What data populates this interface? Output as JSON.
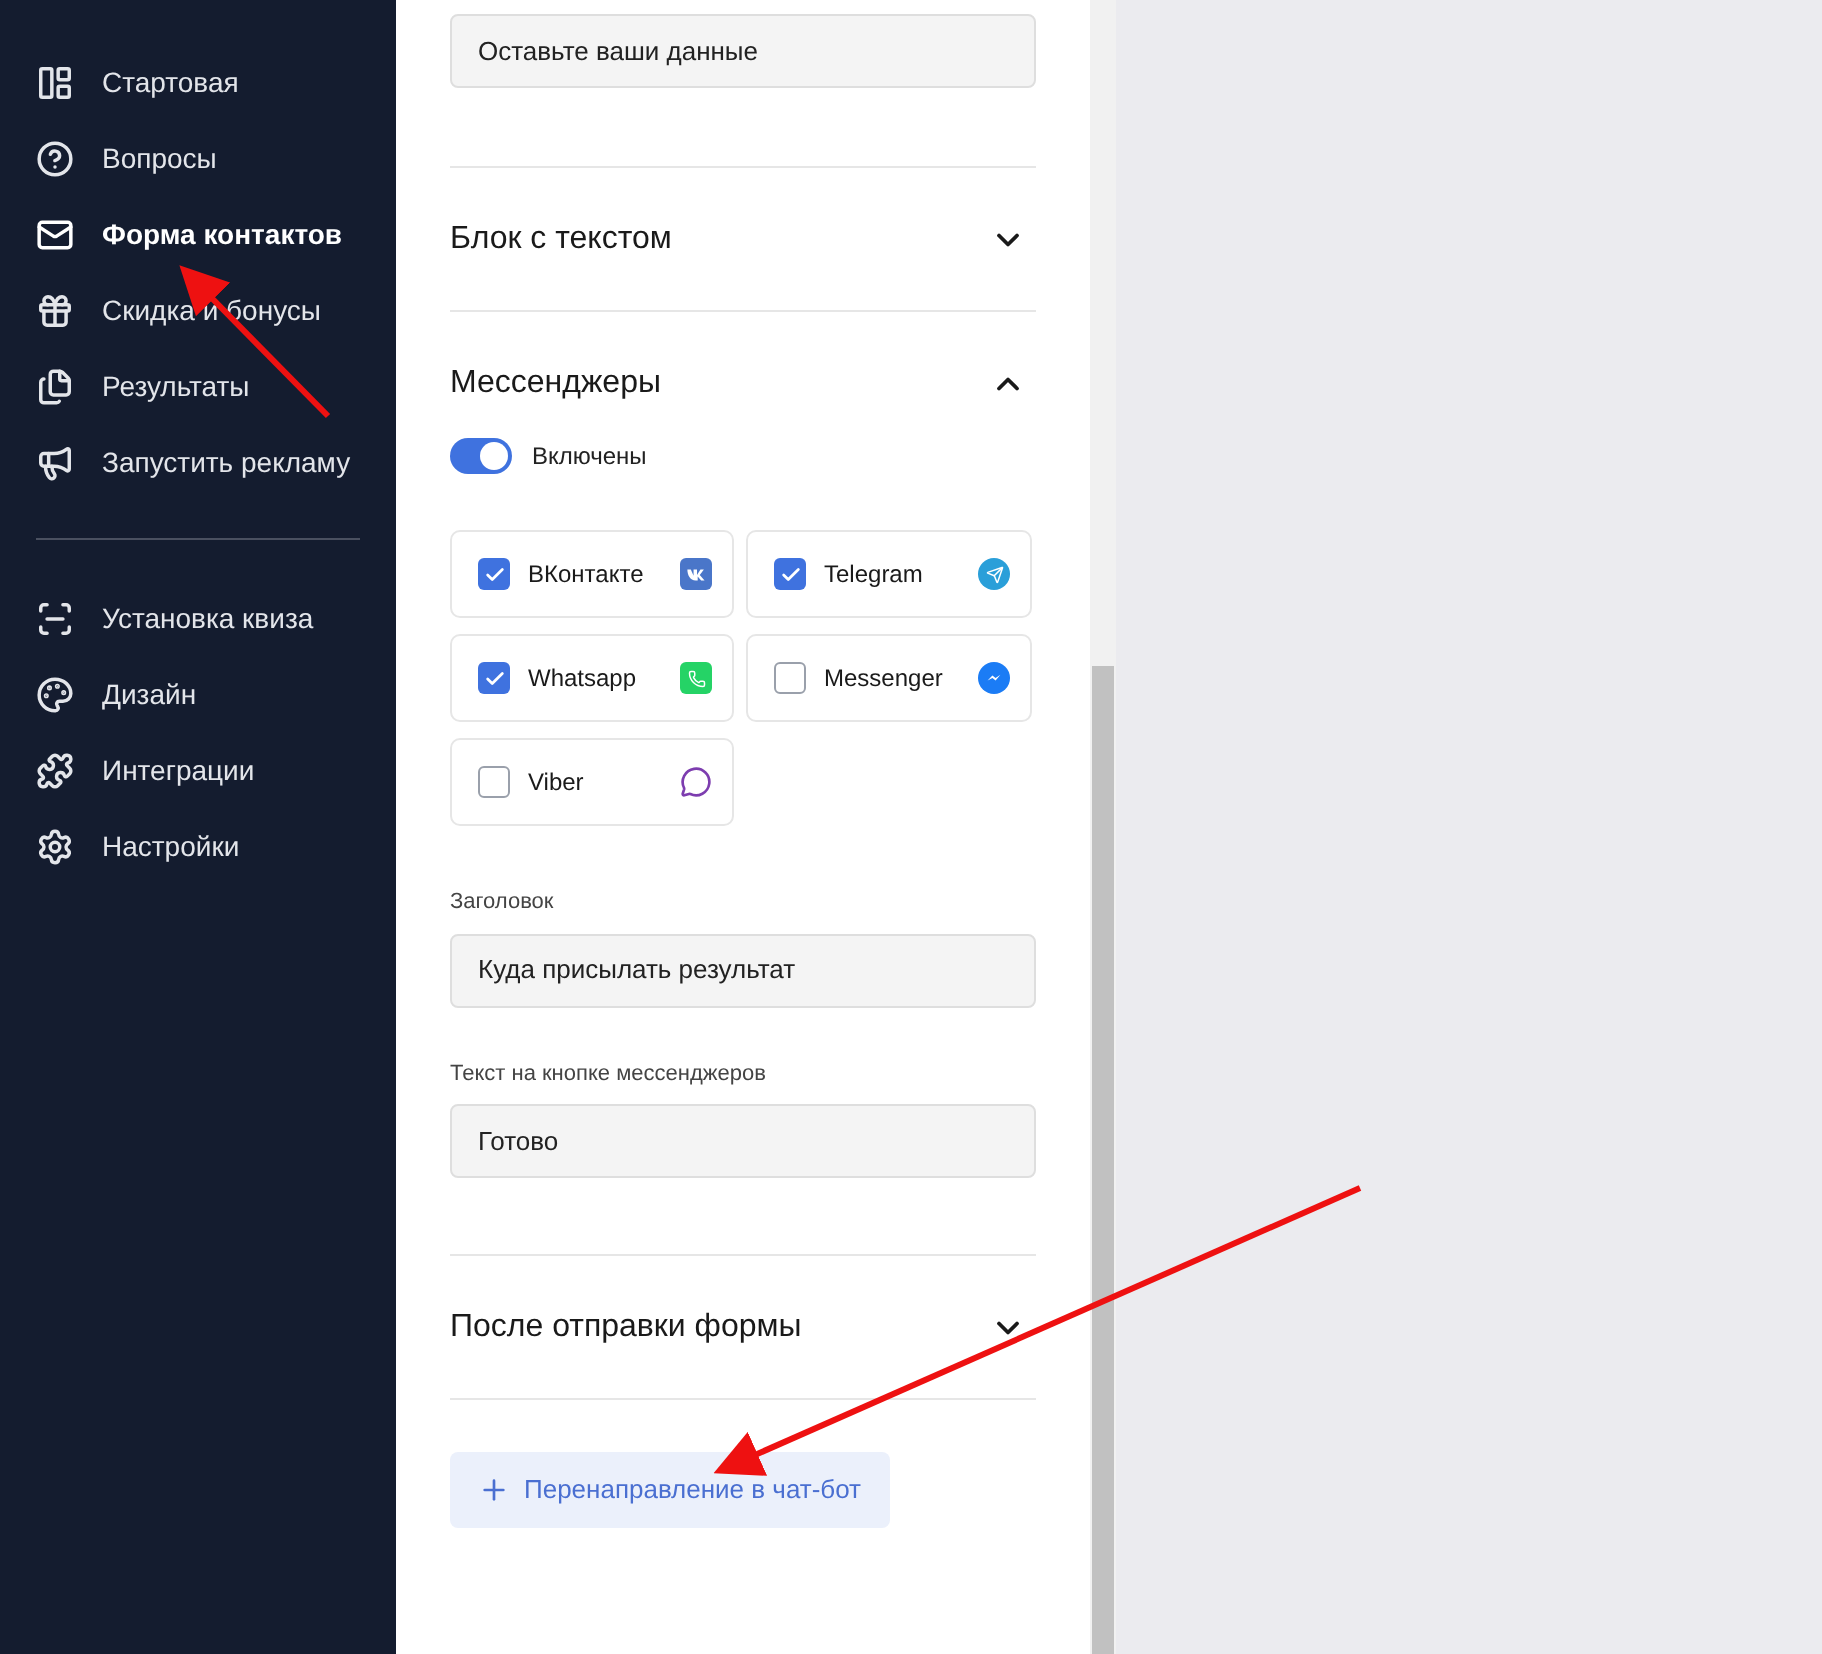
{
  "sidebar": {
    "sections": [
      {
        "items": [
          {
            "label": "Стартовая",
            "selected": false
          },
          {
            "label": "Вопросы",
            "selected": false
          },
          {
            "label": "Форма контактов",
            "selected": true
          },
          {
            "label": "Скидка и бонусы",
            "selected": false
          },
          {
            "label": "Результаты",
            "selected": false
          },
          {
            "label": "Запустить рекламу",
            "selected": false
          }
        ]
      },
      {
        "items": [
          {
            "label": "Установка квиза",
            "selected": false
          },
          {
            "label": "Дизайн",
            "selected": false
          },
          {
            "label": "Интеграции",
            "selected": false
          },
          {
            "label": "Настройки",
            "selected": false
          }
        ]
      }
    ]
  },
  "panel": {
    "top_field": {
      "value": "Оставьте ваши данные"
    },
    "sections": [
      {
        "title": "Блок с текстом",
        "expanded": false
      },
      {
        "title": "Мессенджеры",
        "expanded": true,
        "toggle": {
          "label": "Включены",
          "on": true
        },
        "messengers": [
          {
            "label": "ВКонтакте",
            "checked": true
          },
          {
            "label": "Telegram",
            "checked": true
          },
          {
            "label": "Whatsapp",
            "checked": true
          },
          {
            "label": "Messenger",
            "checked": false
          },
          {
            "label": "Viber",
            "checked": false
          }
        ],
        "fields": [
          {
            "label": "Заголовок",
            "value": "Куда присылать результат"
          },
          {
            "label": "Текст на кнопке мессенджеров",
            "value": "Готово"
          }
        ]
      },
      {
        "title": "После отправки формы",
        "expanded": false
      }
    ],
    "add_button": {
      "label": "Перенаправление в чат-бот"
    }
  }
}
